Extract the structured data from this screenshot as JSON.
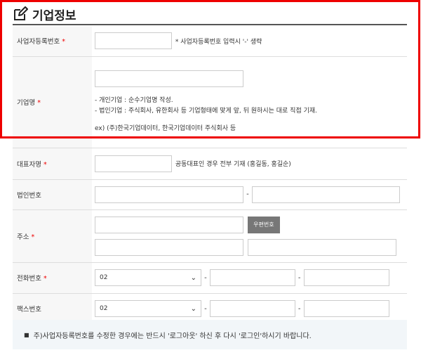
{
  "section_title": "기업정보",
  "rows": {
    "biz_number": {
      "label": "사업자등록번호",
      "required": "*",
      "value": "",
      "note": "* 사업자등록번호 입력시 '-' 생략"
    },
    "company_name": {
      "label": "기업명",
      "required": "*",
      "value": "",
      "hints": [
        "- 개인기업 : 순수기업명 작성.",
        "- 법인기업 : 주식회사, 유한회사 등 기업형태에 맞게 앞, 뒤 원하시는 대로 직접 기재.",
        "ex) (주)한국기업데이터, 한국기업데이터 주식회사 등"
      ]
    },
    "ceo_name": {
      "label": "대표자명",
      "required": "*",
      "value": "",
      "note": "공동대표인 경우 전부 기재 (홍길동, 홍길순)"
    },
    "corp_number": {
      "label": "법인번호",
      "value1": "",
      "value2": "",
      "separator": "-"
    },
    "address": {
      "label": "주소",
      "required": "*",
      "zipcode": "",
      "zip_button": "우편번호",
      "addr1": "",
      "addr2": ""
    },
    "phone": {
      "label": "전화번호",
      "required": "*",
      "area_code": "02",
      "mid": "",
      "last": "",
      "separator": "-"
    },
    "fax": {
      "label": "팩스번호",
      "area_code": "02",
      "mid": "",
      "last": "",
      "separator": "-"
    }
  },
  "notice": "주)사업자등록번호를 수정한 경우에는 반드시 '로그아웃' 하신 후 다시 '로그인'하시기 바랍니다.",
  "colors": {
    "highlight": "#e00000",
    "required": "#e00000",
    "label_bg": "#f7f7f7",
    "notice_bg": "#f2f6f9",
    "zip_button_bg": "#777777"
  }
}
